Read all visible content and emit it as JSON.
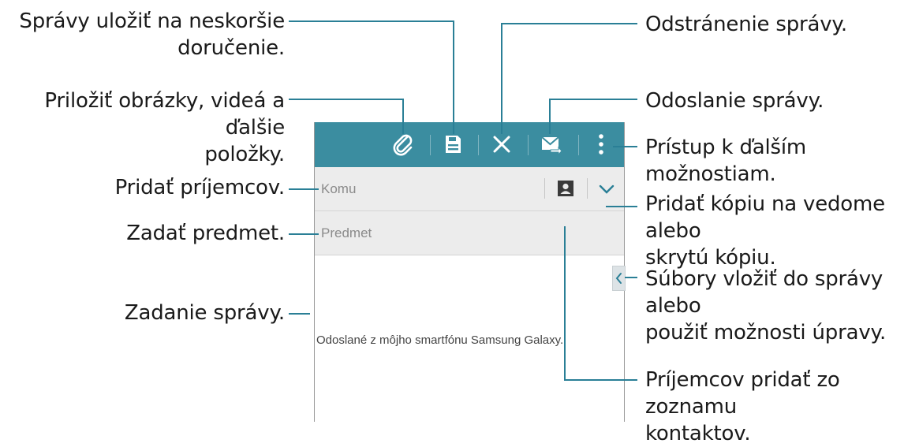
{
  "callouts": {
    "save_later": "Správy uložiť na neskoršie\ndoručenie.",
    "attach": "Priložiť obrázky, videá a ďalšie\npoložky.",
    "add_recipients": "Pridať príjemcov.",
    "enter_subject": "Zadať predmet.",
    "enter_message": "Zadanie správy.",
    "delete": "Odstránenie správy.",
    "send": "Odoslanie správy.",
    "more_options": "Prístup k ďalším možnostiam.",
    "cc_bcc": "Pridať kópiu na vedome alebo\nskrytú kópiu.",
    "insert_files": "Súbory vložiť do správy alebo\npoužiť možnosti úpravy.",
    "from_contacts": "Príjemcov pridať zo zoznamu\nkontaktov."
  },
  "compose": {
    "to_placeholder": "Komu",
    "subject_placeholder": "Predmet",
    "signature": "Odoslané z môjho smartfónu Samsung Galaxy."
  },
  "colors": {
    "action_bar": "#3b8da0",
    "leader_lines": "#2a7f96"
  },
  "icons": [
    "paperclip-icon",
    "save-icon",
    "close-icon",
    "send-mail-icon",
    "overflow-menu-icon",
    "contact-icon",
    "chevron-down-icon",
    "chevron-left-icon"
  ]
}
